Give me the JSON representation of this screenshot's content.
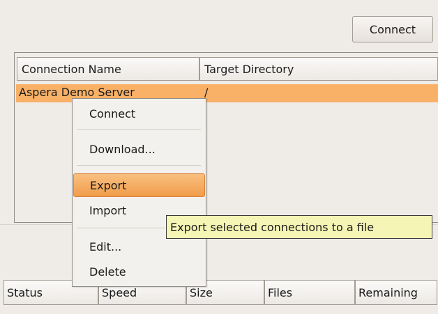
{
  "toolbar": {
    "connect_label": "Connect"
  },
  "connections_table": {
    "columns": [
      "Connection Name",
      "Target Directory"
    ],
    "rows": [
      {
        "name": "Aspera Demo Server",
        "directory": "/"
      }
    ]
  },
  "context_menu": {
    "items": [
      "Connect",
      "Download...",
      "Export",
      "Import",
      "Edit...",
      "Delete"
    ],
    "highlighted": "Export"
  },
  "tooltip": {
    "text": "Export selected connections to a file"
  },
  "transfer_status": {
    "columns": [
      "Status",
      "Speed",
      "Size",
      "Files",
      "Remaining"
    ]
  },
  "colors": {
    "selection": "#f8b167",
    "menu_highlight": "#f19c4b",
    "tooltip_bg": "#f5f5b5",
    "window_bg": "#efebe7"
  }
}
